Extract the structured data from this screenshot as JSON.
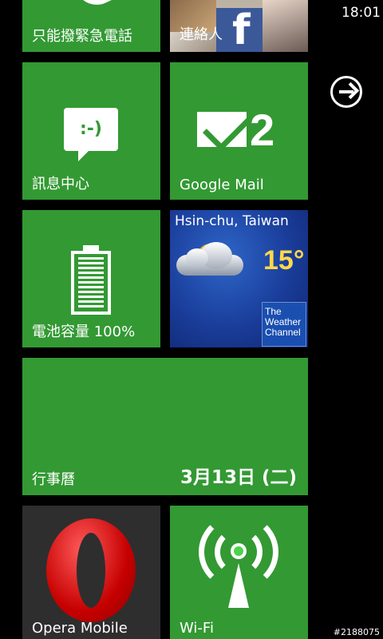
{
  "status_bar": {
    "time": "18:01"
  },
  "tiles": {
    "phone": {
      "label": "只能撥緊急電話"
    },
    "people": {
      "label": "連絡人"
    },
    "messaging": {
      "label": "訊息中心",
      "icon_text": ":-)"
    },
    "mail": {
      "label": "Google Mail",
      "count": "2"
    },
    "battery": {
      "label": "電池容量 100%",
      "level_percent": 100
    },
    "weather": {
      "city": "Hsin-chu, Taiwan",
      "temperature": "15°",
      "provider_line1": "The",
      "provider_line2": "Weather",
      "provider_line3": "Channel"
    },
    "calendar": {
      "label": "行事曆",
      "date": "3月13日 (二)"
    },
    "opera": {
      "label": "Opera Mobile"
    },
    "wifi": {
      "label": "Wi-Fi"
    }
  },
  "icons": {
    "phone": "phone-icon",
    "facebook": "facebook-icon",
    "messaging": "message-bubble-icon",
    "mail": "envelope-icon",
    "battery": "battery-icon",
    "weather": "partly-cloudy-icon",
    "opera": "opera-logo-icon",
    "wifi": "wifi-antenna-icon",
    "arrow": "arrow-right-circle-icon"
  },
  "colors": {
    "tile_accent": "#339933",
    "background": "#000000"
  },
  "watermark": "#2188075"
}
